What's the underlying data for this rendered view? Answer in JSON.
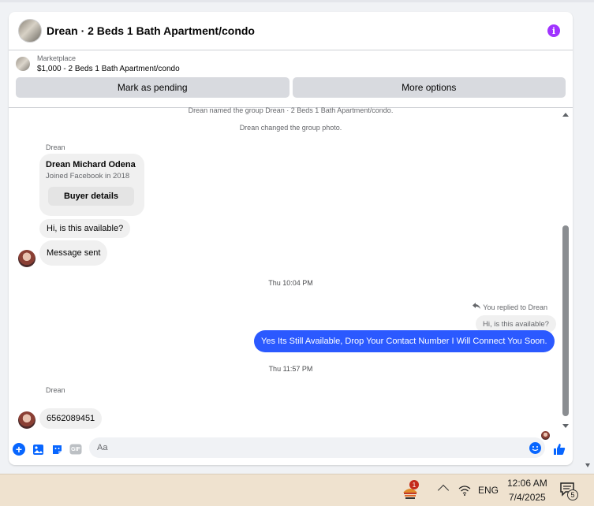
{
  "chat": {
    "title": "Drean · 2 Beds 1 Bath Apartment/condo",
    "marketplace_label": "Marketplace",
    "listing": "$1,000 - 2 Beds 1 Bath Apartment/condo",
    "actions": {
      "mark_pending": "Mark as pending",
      "more_options": "More options"
    },
    "info_icon": "i"
  },
  "messages": {
    "system1": "Drean named the group Drean · 2 Beds 1 Bath Apartment/condo.",
    "system2": "Drean changed the group photo.",
    "sender1": "Drean",
    "buyer_card": {
      "name": "Drean Michard Odena",
      "joined": "Joined Facebook in 2018",
      "button": "Buyer details"
    },
    "incoming1": "Hi, is this available?",
    "incoming2": "Message sent",
    "time1": "Thu 10:04 PM",
    "replied_label": "You replied to Drean",
    "quoted": "Hi, is this available?",
    "outgoing1": "Yes Its Still Available, Drop Your Contact Number I Will Connect You Soon.",
    "time2": "Thu 11:57 PM",
    "sender2": "Drean",
    "incoming3": "6562089451"
  },
  "composer": {
    "placeholder": "Aa",
    "gif_label": "GIF"
  },
  "taskbar": {
    "language": "ENG",
    "time": "12:06 AM",
    "date": "7/4/2025",
    "app_badge": "1",
    "notification_count": "5"
  },
  "colors": {
    "accent": "#0866ff",
    "outgoing_bubble": "#2b59ff",
    "info": "#a033ff",
    "taskbar": "#efe2cf"
  }
}
